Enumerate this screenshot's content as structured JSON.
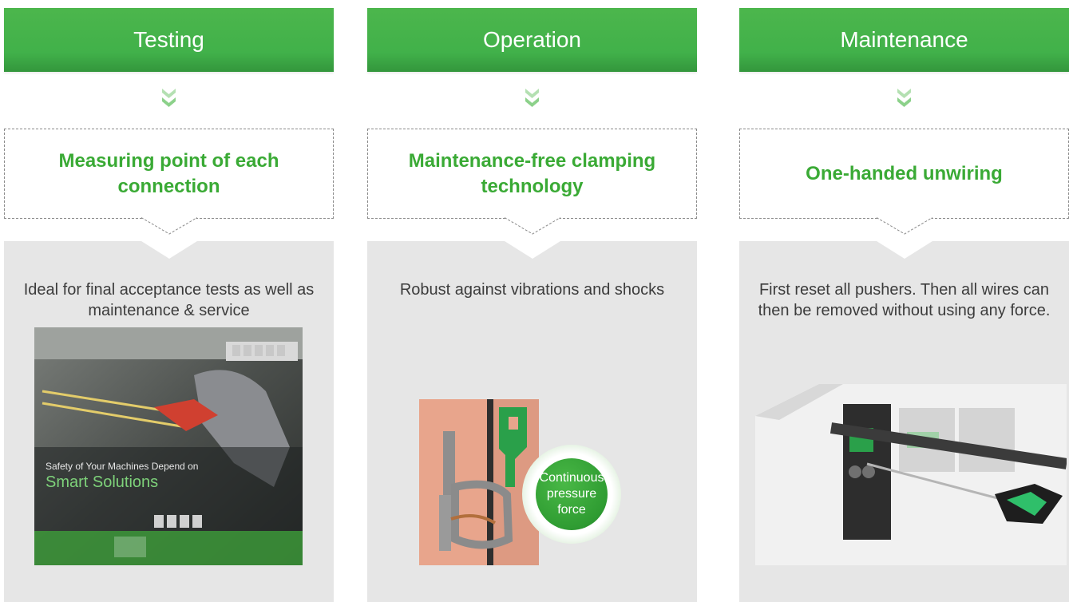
{
  "columns": [
    {
      "header": "Testing",
      "feature": "Measuring point of each connection",
      "description": "Ideal for final acceptance tests as well as maintenance & service",
      "image": {
        "overlay_line1": "Safety of Your Machines Depend on",
        "overlay_line2": "Smart Solutions"
      }
    },
    {
      "header": "Operation",
      "feature": "Maintenance-free clamping technology",
      "description": "Robust against vibrations and shocks",
      "badge": "Continuous pressure force"
    },
    {
      "header": "Maintenance",
      "feature": "One-handed unwiring",
      "description": "First reset all pushers. Then all wires can then be removed without using any force."
    }
  ],
  "colors": {
    "header_green": "#41b14a",
    "feature_green": "#3aaa35",
    "panel_grey": "#e6e6e6",
    "chevron_green": "#8cd18a"
  },
  "icons": [
    "double-chevron-down-icon"
  ]
}
